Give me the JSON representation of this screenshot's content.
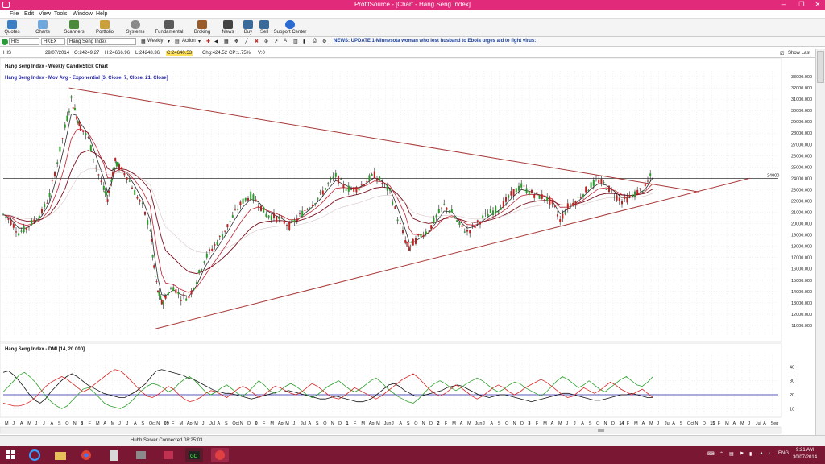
{
  "window": {
    "title": "ProfitSource - [Chart - Hang Seng Index]"
  },
  "menu": [
    "File",
    "Edit",
    "View",
    "Tools",
    "Window",
    "Help"
  ],
  "toolbar": [
    "Quotes",
    "Charts",
    "Scanners",
    "Portfolio",
    "Systems",
    "Fundamental",
    "Broking",
    "News",
    "Buy",
    "Sell",
    "Support Center"
  ],
  "symbolbar": {
    "exchange": "HIS",
    "code": "HKEX",
    "name": "Hang Seng Index",
    "period": "Weekly",
    "action": "Action",
    "news": "NEWS: UPDATE 1-Minnesota woman who lost husband to Ebola urges aid to fight virus:"
  },
  "infobar": {
    "symbol": "HIS",
    "date": "29/07/2014",
    "open": "O:24249.27",
    "high": "H:24666.96",
    "low": "L:24248.36",
    "close": "C:24640.53",
    "chg": "Chg:424.52",
    "chgpct": "CP:1.75%",
    "vol": "V:0",
    "show_last": "Show Last"
  },
  "chart_data": [
    {
      "type": "line",
      "title": "Hang Seng Index - Weekly CandleStick Chart",
      "subtitle": "Hang Seng Index - Mov Avg - Exponential [3, Close, 7, Close, 21, Close]",
      "ylim": [
        10000,
        33500
      ],
      "yticks": [
        11000,
        12000,
        13000,
        14000,
        15000,
        16000,
        17000,
        18000,
        19000,
        20000,
        21000,
        22000,
        23000,
        24000,
        25000,
        26000,
        27000,
        28000,
        29000,
        30000,
        31000,
        32000,
        33000
      ],
      "hline": {
        "value": 24000,
        "label": "24000",
        "color": "#333333"
      },
      "trendlines": [
        {
          "name": "upper",
          "from": [
            0.085,
            32000
          ],
          "to": [
            0.9,
            22800
          ],
          "color": "#a83838"
        },
        {
          "name": "lower",
          "from": [
            0.197,
            10700
          ],
          "to": [
            0.965,
            24000
          ],
          "color": "#a83838"
        }
      ],
      "price": [
        [
          0.0,
          20800
        ],
        [
          0.01,
          20200
        ],
        [
          0.02,
          19200
        ],
        [
          0.03,
          19600
        ],
        [
          0.04,
          20300
        ],
        [
          0.05,
          21000
        ],
        [
          0.06,
          22500
        ],
        [
          0.07,
          25500
        ],
        [
          0.08,
          28500
        ],
        [
          0.088,
          31000
        ],
        [
          0.095,
          29500
        ],
        [
          0.1,
          28500
        ],
        [
          0.11,
          27500
        ],
        [
          0.12,
          25000
        ],
        [
          0.13,
          23000
        ],
        [
          0.135,
          22200
        ],
        [
          0.14,
          24000
        ],
        [
          0.145,
          25500
        ],
        [
          0.15,
          25000
        ],
        [
          0.16,
          24200
        ],
        [
          0.17,
          22800
        ],
        [
          0.18,
          21500
        ],
        [
          0.19,
          19500
        ],
        [
          0.195,
          16000
        ],
        [
          0.2,
          14000
        ],
        [
          0.205,
          13000
        ],
        [
          0.21,
          13600
        ],
        [
          0.22,
          14400
        ],
        [
          0.23,
          13500
        ],
        [
          0.24,
          13500
        ],
        [
          0.25,
          15000
        ],
        [
          0.26,
          16800
        ],
        [
          0.27,
          17800
        ],
        [
          0.28,
          18700
        ],
        [
          0.29,
          19800
        ],
        [
          0.3,
          21000
        ],
        [
          0.31,
          22000
        ],
        [
          0.32,
          22500
        ],
        [
          0.33,
          21800
        ],
        [
          0.34,
          20800
        ],
        [
          0.35,
          20600
        ],
        [
          0.36,
          20300
        ],
        [
          0.37,
          19800
        ],
        [
          0.38,
          20400
        ],
        [
          0.39,
          21200
        ],
        [
          0.4,
          21800
        ],
        [
          0.41,
          22500
        ],
        [
          0.42,
          23500
        ],
        [
          0.43,
          24200
        ],
        [
          0.44,
          23300
        ],
        [
          0.45,
          23000
        ],
        [
          0.46,
          23200
        ],
        [
          0.47,
          23800
        ],
        [
          0.48,
          24300
        ],
        [
          0.49,
          23600
        ],
        [
          0.5,
          22800
        ],
        [
          0.51,
          20500
        ],
        [
          0.52,
          18500
        ],
        [
          0.525,
          17800
        ],
        [
          0.53,
          18300
        ],
        [
          0.54,
          19000
        ],
        [
          0.55,
          19400
        ],
        [
          0.56,
          20600
        ],
        [
          0.57,
          21600
        ],
        [
          0.58,
          21000
        ],
        [
          0.59,
          19800
        ],
        [
          0.6,
          19300
        ],
        [
          0.61,
          19800
        ],
        [
          0.62,
          20500
        ],
        [
          0.63,
          21000
        ],
        [
          0.64,
          21300
        ],
        [
          0.65,
          22000
        ],
        [
          0.66,
          22800
        ],
        [
          0.67,
          23300
        ],
        [
          0.68,
          22800
        ],
        [
          0.69,
          22500
        ],
        [
          0.7,
          22300
        ],
        [
          0.71,
          21800
        ],
        [
          0.72,
          20300
        ],
        [
          0.73,
          21500
        ],
        [
          0.74,
          22000
        ],
        [
          0.75,
          22700
        ],
        [
          0.76,
          23400
        ],
        [
          0.77,
          23800
        ],
        [
          0.78,
          23300
        ],
        [
          0.79,
          22600
        ],
        [
          0.8,
          22000
        ],
        [
          0.81,
          22300
        ],
        [
          0.82,
          22800
        ],
        [
          0.83,
          23200
        ],
        [
          0.84,
          24600
        ]
      ],
      "ema3": {
        "color": "#2a2a2a"
      },
      "ema7": {
        "color": "#c02030"
      },
      "ema21": {
        "color": "#7a1020"
      }
    },
    {
      "type": "line",
      "title": "Hang Seng Index - DMI [14, 20.000]",
      "ylim": [
        5,
        50
      ],
      "yticks": [
        10,
        20,
        30,
        40
      ],
      "hline": {
        "value": 20,
        "color": "#2020aa"
      },
      "series": [
        {
          "key": "adx",
          "color": "#111111",
          "values": [
            36,
            37,
            34,
            30,
            25,
            20,
            16,
            14,
            17,
            22,
            26,
            30,
            33,
            35,
            33,
            30,
            27,
            25,
            23,
            21,
            20,
            19,
            18,
            18,
            20,
            22,
            25,
            28,
            33,
            37,
            38,
            37,
            36,
            35,
            34,
            32,
            31,
            29,
            27,
            25,
            23,
            22,
            21,
            21,
            20,
            19,
            18,
            17,
            18,
            19,
            20,
            21,
            22,
            22,
            23,
            22,
            21,
            20,
            19,
            18,
            17,
            17,
            18,
            19,
            18,
            17,
            16,
            15,
            15,
            16,
            18,
            21,
            24,
            27,
            28,
            26,
            23,
            21,
            19,
            19,
            20,
            21,
            22,
            23,
            25,
            26,
            27,
            26,
            24,
            22,
            20,
            19,
            18,
            19,
            20,
            20,
            19,
            18,
            17,
            16,
            15,
            16,
            17,
            18,
            19,
            20,
            21,
            21,
            20,
            19,
            18,
            17,
            16,
            16,
            17,
            18,
            19,
            20,
            20,
            21,
            20,
            19,
            18,
            18
          ]
        },
        {
          "key": "plus_di",
          "color": "#2ca02c",
          "values": [
            22,
            26,
            30,
            34,
            36,
            33,
            29,
            24,
            19,
            15,
            12,
            10,
            12,
            16,
            20,
            24,
            25,
            22,
            18,
            14,
            12,
            11,
            10,
            12,
            15,
            19,
            23,
            26,
            28,
            27,
            25,
            22,
            24,
            28,
            31,
            33,
            30,
            26,
            22,
            20,
            22,
            25,
            27,
            24,
            21,
            19,
            22,
            26,
            30,
            27,
            23,
            21,
            23,
            26,
            28,
            26,
            23,
            20,
            18,
            20,
            23,
            26,
            28,
            30,
            27,
            24,
            22,
            24,
            27,
            30,
            32,
            29,
            25,
            22,
            19,
            17,
            15,
            14,
            17,
            21,
            25,
            28,
            30,
            28,
            25,
            23,
            25,
            28,
            30,
            32,
            30,
            27,
            24,
            22,
            24,
            27,
            29,
            28,
            25,
            23,
            21,
            19,
            22,
            26,
            30,
            33,
            31,
            28,
            25,
            27,
            30,
            27,
            24,
            22,
            25,
            28,
            31,
            33,
            30,
            27,
            26,
            29,
            33
          ]
        },
        {
          "key": "minus_di",
          "color": "#d62728",
          "values": [
            14,
            13,
            12,
            12,
            13,
            15,
            18,
            22,
            26,
            29,
            31,
            33,
            31,
            28,
            25,
            22,
            24,
            27,
            30,
            33,
            36,
            38,
            37,
            34,
            30,
            26,
            22,
            19,
            18,
            20,
            23,
            26,
            24,
            20,
            17,
            15,
            16,
            18,
            21,
            23,
            22,
            20,
            18,
            21,
            24,
            26,
            24,
            21,
            18,
            20,
            23,
            26,
            25,
            23,
            21,
            20,
            22,
            25,
            28,
            26,
            23,
            20,
            18,
            17,
            19,
            22,
            25,
            23,
            21,
            19,
            17,
            19,
            22,
            25,
            28,
            31,
            33,
            35,
            32,
            28,
            24,
            21,
            19,
            21,
            24,
            27,
            25,
            22,
            19,
            17,
            19,
            22,
            25,
            27,
            25,
            22,
            20,
            22,
            25,
            27,
            29,
            31,
            29,
            26,
            23,
            20,
            18,
            19,
            22,
            25,
            23,
            21,
            23,
            26,
            29,
            27,
            24,
            22,
            20,
            22,
            24,
            21,
            18
          ]
        }
      ]
    }
  ],
  "xaxis": {
    "labels": [
      "M",
      "J",
      "A",
      "M",
      "J",
      "J",
      "A",
      "S",
      "O",
      "N",
      "8",
      "F",
      "M",
      "A",
      "M",
      "J",
      "J",
      "A",
      "S",
      "Oct",
      "N",
      "09",
      "F",
      "M",
      "Apr",
      "M",
      "J",
      "Jul",
      "A",
      "S",
      "Oct",
      "N",
      "D",
      "0",
      "F",
      "M",
      "Apr",
      "M",
      "J",
      "Jul",
      "A",
      "S",
      "O",
      "N",
      "D",
      "1",
      "F",
      "M",
      "Apr",
      "M",
      "Jun",
      "J",
      "A",
      "S",
      "O",
      "N",
      "D",
      "2",
      "F",
      "M",
      "A",
      "M",
      "Jun",
      "J",
      "A",
      "S",
      "O",
      "N",
      "D",
      "3",
      "F",
      "M",
      "A",
      "M",
      "J",
      "J",
      "A",
      "S",
      "O",
      "N",
      "D",
      "14",
      "F",
      "M",
      "A",
      "M",
      "J",
      "Jul",
      "A",
      "S",
      "Oct",
      "N",
      "D",
      "15",
      "F",
      "M",
      "A",
      "M",
      "J",
      "Jul",
      "A",
      "Sep"
    ]
  },
  "status": {
    "server": "Hubb Server Connected 08:25:03"
  },
  "taskbar": {
    "lang": "ENG",
    "time": "9:21 AM",
    "date": "30/07/2014"
  }
}
